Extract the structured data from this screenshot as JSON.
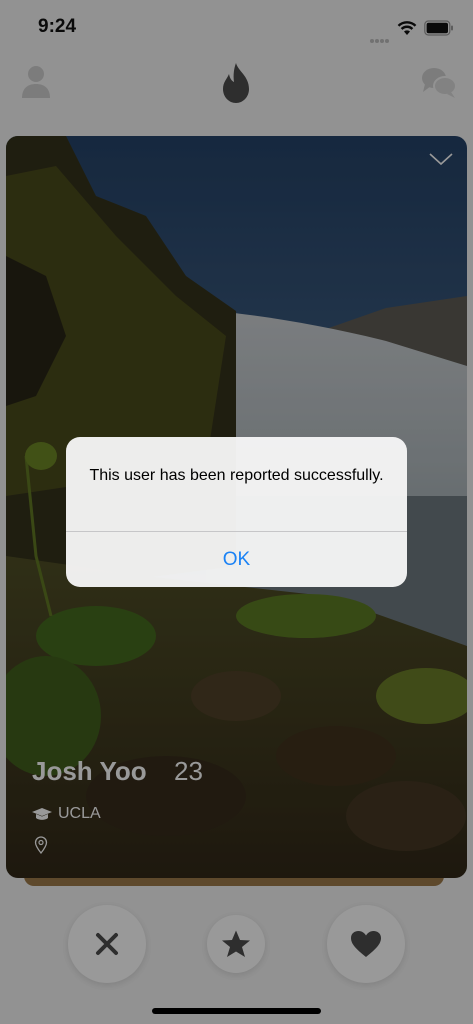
{
  "status_bar": {
    "time": "9:24"
  },
  "nav": {
    "left_icon": "profile-icon",
    "center_icon": "flame-icon",
    "right_icon": "chat-icon",
    "inactive_color": "#cfcfcf",
    "brand_color": "#4d4d4d"
  },
  "card": {
    "name": "Josh Yoo",
    "age": "23",
    "school": "UCLA",
    "school_icon": "graduation-cap-icon",
    "location_icon": "location-pin-icon",
    "collapse_icon": "chevron-down-icon"
  },
  "actions": {
    "nope_icon": "close-icon",
    "superlike_icon": "star-icon",
    "like_icon": "heart-icon"
  },
  "alert": {
    "message": "This user has been reported successfully.",
    "ok_label": "OK",
    "ok_color": "#1a82f5"
  }
}
